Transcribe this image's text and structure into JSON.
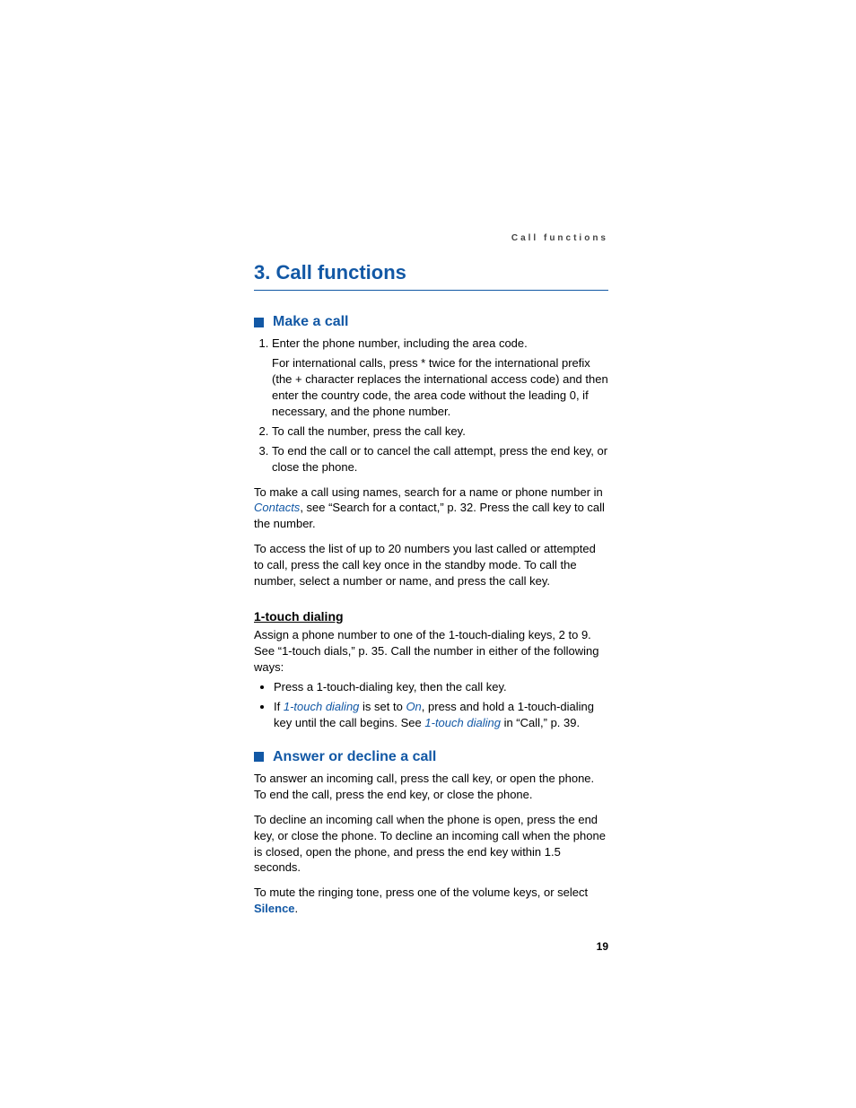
{
  "runningHead": "Call functions",
  "chapter": "3.   Call functions",
  "sec1": {
    "title": "Make a call",
    "steps": [
      {
        "main": "Enter the phone number, including the area code.",
        "sub": "For international calls, press * twice for the international prefix (the + character replaces the international access code) and then enter the country code, the area code without the leading 0, if necessary, and the phone number."
      },
      {
        "main": "To call the number, press the call key."
      },
      {
        "main": "To end the call or to cancel the call attempt, press the end key, or close the phone."
      }
    ],
    "p1a": "To make a call using names, search for a name or phone number in ",
    "p1link": "Contacts",
    "p1b": ", see “Search for a contact,” p. 32. Press the call key to call the number.",
    "p2": "To access the list of up to 20 numbers you last called or attempted to call, press the call key once in the standby mode. To call the number, select a number or name, and press the call key."
  },
  "sub1": {
    "title": "1-touch dialing",
    "intro": "Assign a phone number to one of the 1-touch-dialing keys, 2 to 9. See “1-touch dials,” p. 35. Call the number in either of the following ways:",
    "b1": "Press a 1-touch-dialing key, then the call key.",
    "b2a": "If ",
    "b2link1": "1-touch dialing",
    "b2b": " is set to ",
    "b2link2": "On",
    "b2c": ", press and hold a 1-touch-dialing key until the call begins. See ",
    "b2link3": "1-touch dialing",
    "b2d": " in “Call,” p. 39."
  },
  "sec2": {
    "title": "Answer or decline a call",
    "p1": "To answer an incoming call, press the call key, or open the phone. To end the call, press the end key, or close the phone.",
    "p2": "To decline an incoming call when the phone is open, press the end key, or close the phone. To decline an incoming call when the phone is closed, open the phone, and press the end key within 1.5 seconds.",
    "p3a": "To mute the ringing tone, press one of the volume keys, or select ",
    "p3link": "Silence",
    "p3b": "."
  },
  "pageNumber": "19"
}
